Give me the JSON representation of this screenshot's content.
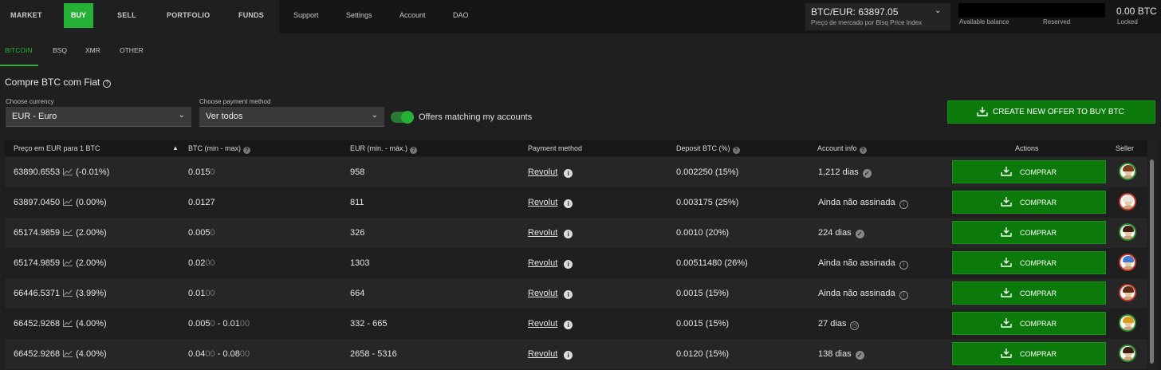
{
  "topnav": {
    "items": [
      "MARKET",
      "BUY",
      "SELL",
      "PORTFOLIO",
      "FUNDS"
    ],
    "right_items": [
      "Support",
      "Settings",
      "Account",
      "DAO"
    ]
  },
  "market": {
    "price": "BTC/EUR: 63897.05",
    "subtitle": "Preço de mercado por Bisq Price Index"
  },
  "balance": {
    "available_label": "Available balance",
    "reserved_label": "Reserved",
    "locked_value": "0.00 BTC",
    "locked_label": "Locked"
  },
  "subtabs": [
    "BITCOIN",
    "BSQ",
    "XMR",
    "OTHER"
  ],
  "page": {
    "title": "Compre BTC com Fiat",
    "currency_label": "Choose currency",
    "currency_value": "EUR  -  Euro",
    "payment_label": "Choose payment method",
    "payment_value": "Ver todos",
    "toggle_label": "Offers matching my accounts",
    "create_button": "CREATE NEW OFFER TO BUY BTC"
  },
  "table": {
    "headers": {
      "price": "Preço em EUR para 1 BTC",
      "btc": "BTC (min - max)",
      "eur": "EUR (min. - máx.)",
      "payment": "Payment method",
      "deposit": "Deposit BTC (%)",
      "account": "Account info",
      "actions": "Actions",
      "seller": "Seller"
    },
    "buy_label": "COMPRAR",
    "rows": [
      {
        "price": "63890.6553",
        "pct": "(-0.01%)",
        "btc_min": "0.015",
        "btc_min_dim": "0",
        "btc_max": "",
        "btc_max_dim": "",
        "eur": "958",
        "payment": "Revolut",
        "deposit": "0.002250 (15%)",
        "account": "1,212 dias",
        "account_badge": "check"
      },
      {
        "price": "63897.0450",
        "pct": "(0.00%)",
        "btc_min": "0.0127",
        "btc_min_dim": "",
        "btc_max": "",
        "btc_max_dim": "",
        "eur": "811",
        "payment": "Revolut",
        "deposit": "0.003175 (25%)",
        "account": "Ainda não assinada",
        "account_badge": "info"
      },
      {
        "price": "65174.9859",
        "pct": "(2.00%)",
        "btc_min": "0.005",
        "btc_min_dim": "0",
        "btc_max": "",
        "btc_max_dim": "",
        "eur": "326",
        "payment": "Revolut",
        "deposit": "0.0010 (20%)",
        "account": "224 dias",
        "account_badge": "check"
      },
      {
        "price": "65174.9859",
        "pct": "(2.00%)",
        "btc_min": "0.02",
        "btc_min_dim": "00",
        "btc_max": "",
        "btc_max_dim": "",
        "eur": "1303",
        "payment": "Revolut",
        "deposit": "0.00511480 (26%)",
        "account": "Ainda não assinada",
        "account_badge": "info"
      },
      {
        "price": "66446.5371",
        "pct": "(3.99%)",
        "btc_min": "0.01",
        "btc_min_dim": "00",
        "btc_max": "",
        "btc_max_dim": "",
        "eur": "664",
        "payment": "Revolut",
        "deposit": "0.0015 (15%)",
        "account": "Ainda não assinada",
        "account_badge": "info"
      },
      {
        "price": "66452.9268",
        "pct": "(4.00%)",
        "btc_min": "0.005",
        "btc_min_dim": "0",
        "btc_max": "0.01",
        "btc_max_dim": "00",
        "eur": "332 - 665",
        "payment": "Revolut",
        "deposit": "0.0015 (15%)",
        "account": "27 dias",
        "account_badge": "clock"
      },
      {
        "price": "66452.9268",
        "pct": "(4.00%)",
        "btc_min": "0.04",
        "btc_min_dim": "00",
        "btc_max": "0.08",
        "btc_max_dim": "00",
        "eur": "2658 - 5316",
        "payment": "Revolut",
        "deposit": "0.0120 (15%)",
        "account": "138 dias",
        "account_badge": "check"
      }
    ]
  },
  "colors": {
    "accent": "#25b135",
    "button": "#0b7a0b"
  }
}
